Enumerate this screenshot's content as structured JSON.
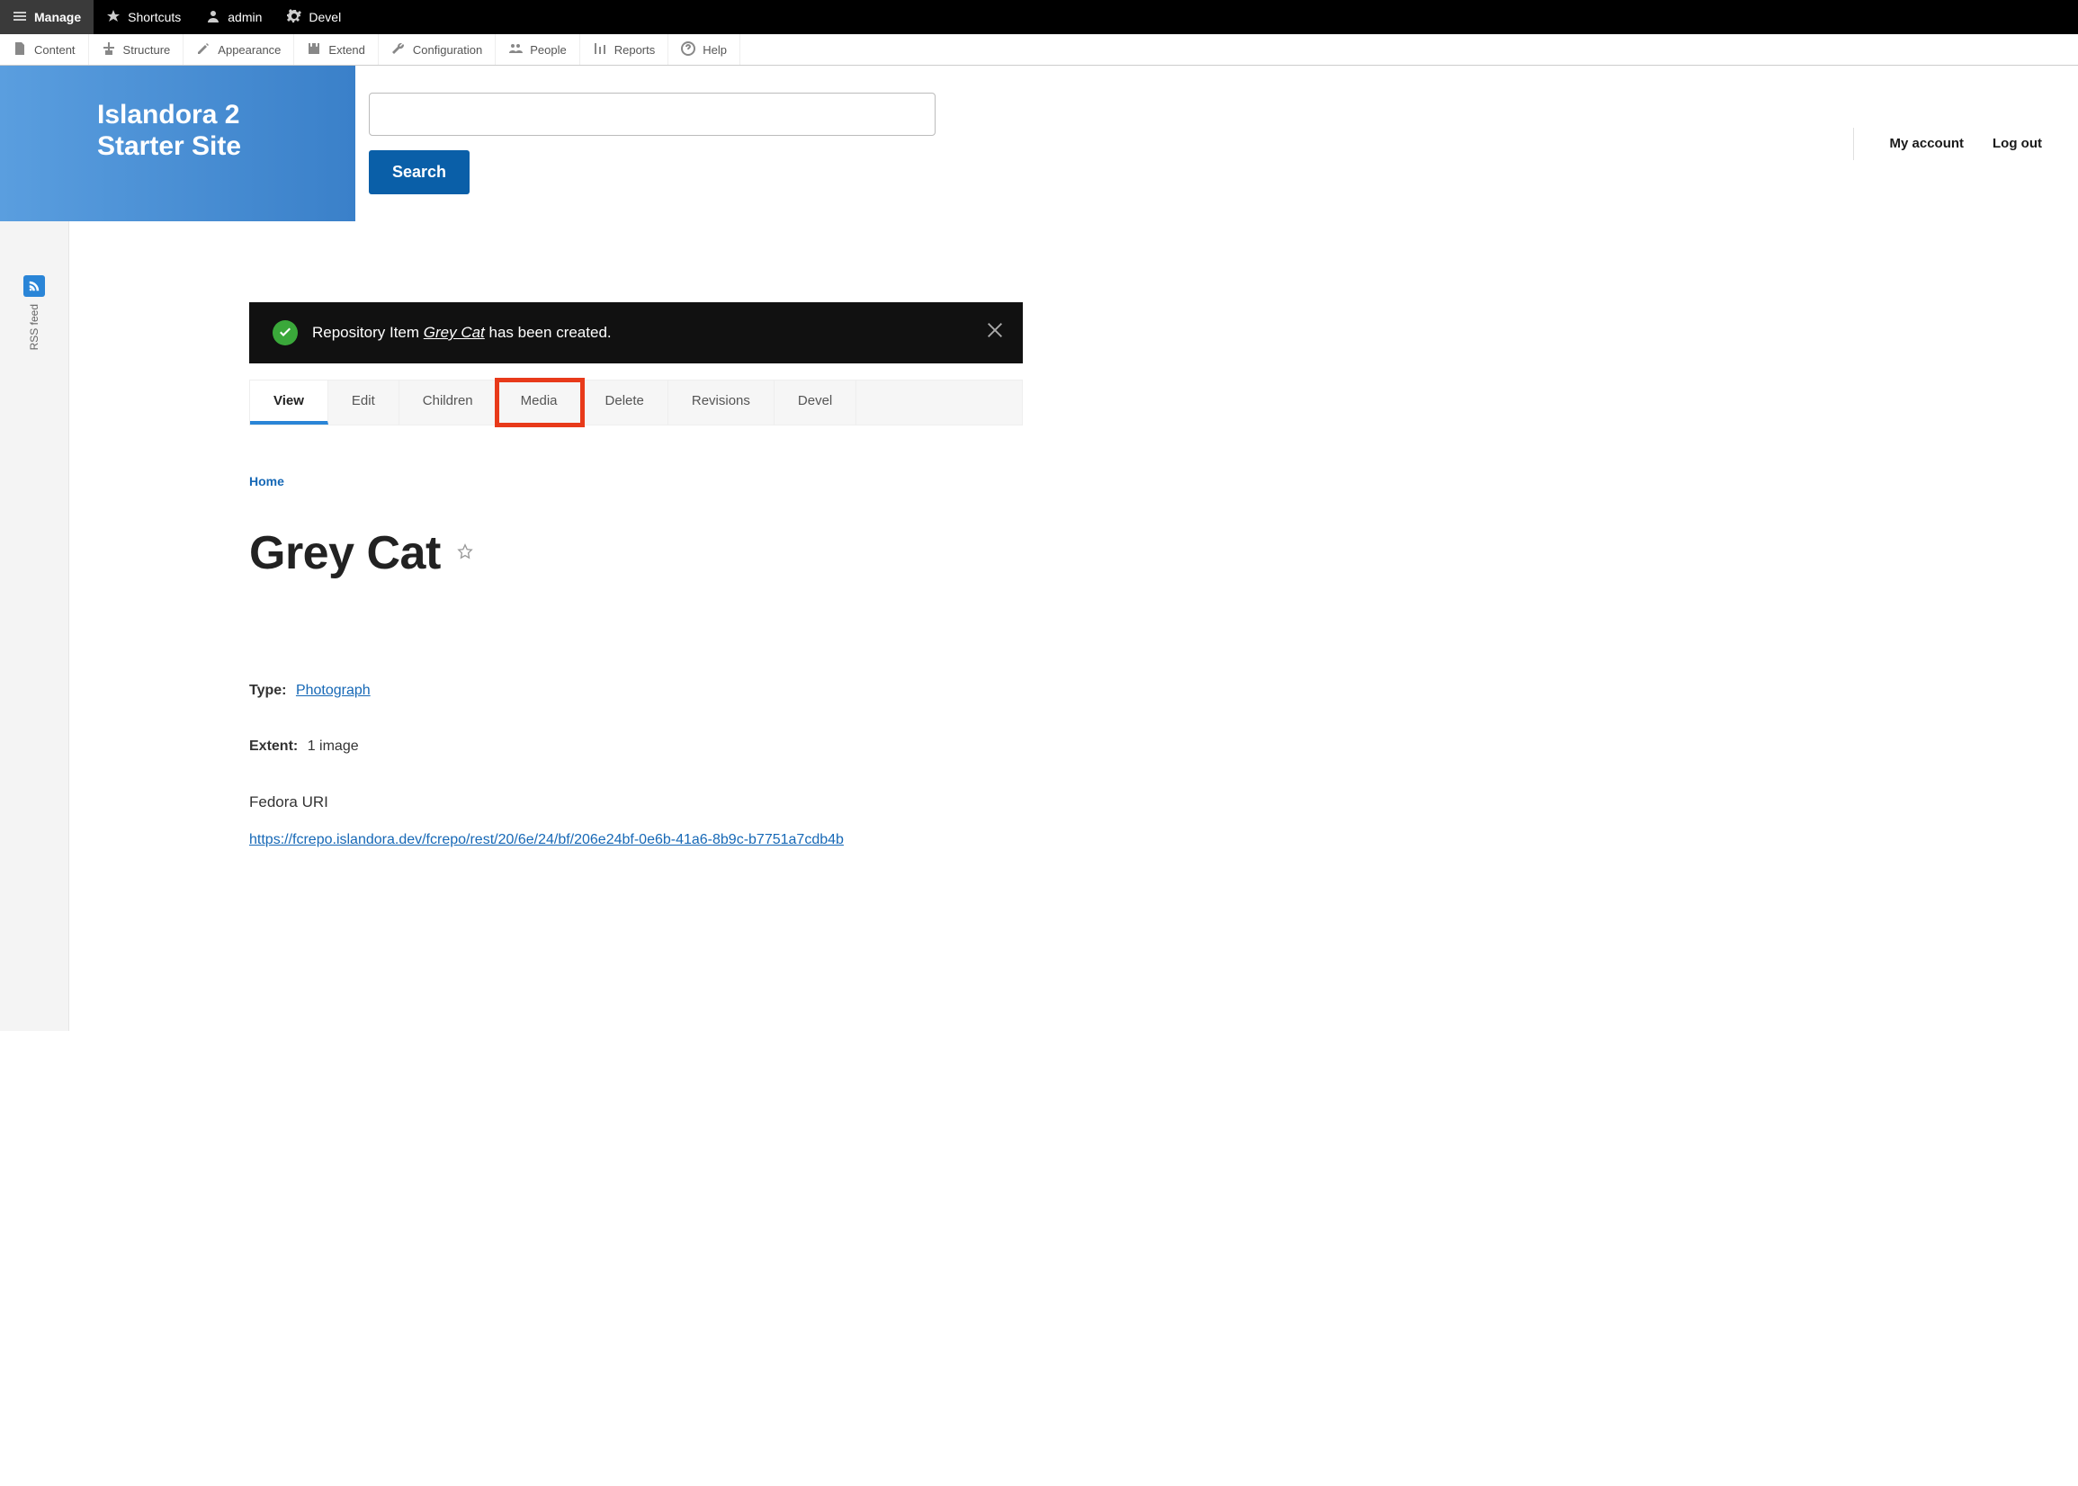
{
  "topbar": {
    "manage": "Manage",
    "shortcuts": "Shortcuts",
    "admin": "admin",
    "devel": "Devel"
  },
  "secondbar": {
    "content": "Content",
    "structure": "Structure",
    "appearance": "Appearance",
    "extend": "Extend",
    "configuration": "Configuration",
    "people": "People",
    "reports": "Reports",
    "help": "Help"
  },
  "brand": {
    "line1": "Islandora 2",
    "line2": "Starter Site"
  },
  "search": {
    "button": "Search"
  },
  "userlinks": {
    "account": "My account",
    "logout": "Log out"
  },
  "sidebar": {
    "rss": "RSS feed"
  },
  "status": {
    "prefix": "Repository Item ",
    "item": "Grey Cat",
    "suffix": " has been created."
  },
  "tabs": {
    "view": "View",
    "edit": "Edit",
    "children": "Children",
    "media": "Media",
    "delete": "Delete",
    "revisions": "Revisions",
    "devel": "Devel"
  },
  "breadcrumb": {
    "home": "Home"
  },
  "title": "Grey Cat",
  "fields": {
    "type_label": "Type:",
    "type_value": "Photograph",
    "extent_label": "Extent:",
    "extent_value": "1 image",
    "fedora_label": "Fedora URI",
    "fedora_uri": "https://fcrepo.islandora.dev/fcrepo/rest/20/6e/24/bf/206e24bf-0e6b-41a6-8b9c-b7751a7cdb4b"
  }
}
